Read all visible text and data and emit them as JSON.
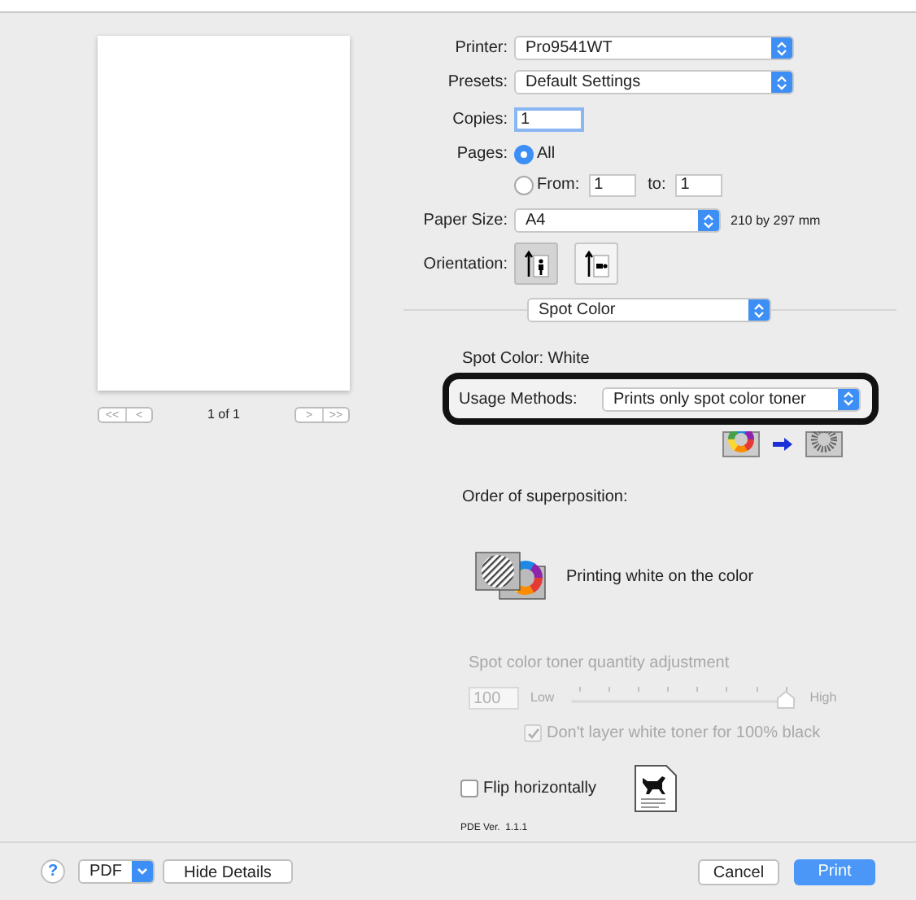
{
  "preview": {
    "nav_back": [
      "<<",
      "<"
    ],
    "page_indicator": "1 of 1",
    "nav_forward": [
      ">",
      ">>"
    ]
  },
  "printer": {
    "label": "Printer:",
    "value": "Pro9541WT"
  },
  "presets": {
    "label": "Presets:",
    "value": "Default Settings"
  },
  "copies": {
    "label": "Copies:",
    "value": "1"
  },
  "pages": {
    "label": "Pages:",
    "options": [
      {
        "label": "All",
        "selected": true
      },
      {
        "label": "From:",
        "selected": false
      }
    ],
    "from": "1",
    "to_label": "to:",
    "to": "1"
  },
  "paper_size": {
    "label": "Paper Size:",
    "value": "A4",
    "dimensions": "210 by 297 mm"
  },
  "orientation": {
    "label": "Orientation:",
    "options": [
      {
        "kind": "portrait",
        "selected": true
      },
      {
        "kind": "landscape",
        "selected": false
      }
    ]
  },
  "panel_menu": {
    "value": "Spot Color"
  },
  "spot_color": "Spot Color: White",
  "usage_methods": {
    "label": "Usage Methods:",
    "value": "Prints only spot color toner"
  },
  "superposition": {
    "label": "Order of superposition:",
    "option": "Printing white on the color"
  },
  "toner_adjustment": {
    "title": "Spot color toner quantity adjustment",
    "value": "100",
    "low": "Low",
    "high": "High",
    "level": 1,
    "disabled": true
  },
  "no_white_on_black": {
    "label": "Don't layer white toner for 100% black",
    "checked": true,
    "disabled": true
  },
  "flip_horizontally": {
    "label": "Flip horizontally",
    "checked": false
  },
  "version": "PDE Ver.  1.1.1",
  "footer": {
    "help": "?",
    "pdf": "PDF",
    "hide_details": "Hide Details",
    "cancel": "Cancel",
    "print": "Print"
  }
}
